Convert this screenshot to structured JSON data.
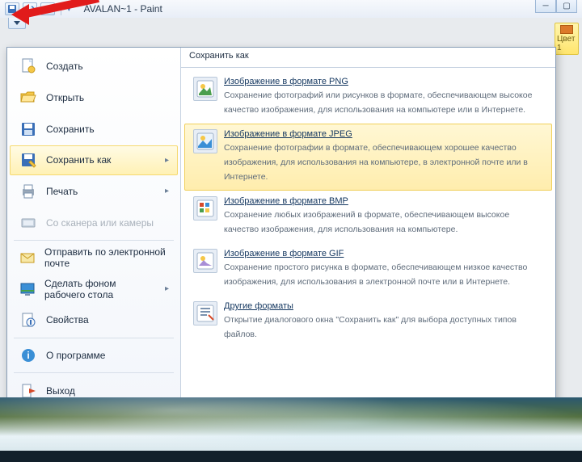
{
  "title": "AVALAN~1 - Paint",
  "panel_header": "Сохранить как",
  "menu_left": [
    {
      "label": "Создать",
      "icon": "new-doc"
    },
    {
      "label": "Открыть",
      "icon": "folder-open"
    },
    {
      "label": "Сохранить",
      "icon": "save"
    },
    {
      "label": "Сохранить как",
      "icon": "save-as",
      "submenu": true,
      "selected": true
    },
    {
      "label": "Печать",
      "icon": "printer",
      "submenu": true
    },
    {
      "label": "Со сканера или камеры",
      "icon": "scanner",
      "disabled": true
    },
    {
      "label": "Отправить по электронной почте",
      "icon": "mail"
    },
    {
      "label": "Сделать фоном рабочего стола",
      "icon": "desktop-bg",
      "submenu": true
    },
    {
      "label": "Свойства",
      "icon": "properties"
    },
    {
      "label": "О программе",
      "icon": "info"
    },
    {
      "label": "Выход",
      "icon": "exit"
    }
  ],
  "formats": [
    {
      "title": "Изображение в формате PNG",
      "desc": "Сохранение фотографий или рисунков в формате, обеспечивающем высокое качество изображения, для использования на компьютере или в Интернете.",
      "icon": "png"
    },
    {
      "title": "Изображение в формате JPEG",
      "desc": "Сохранение фотографии в формате, обеспечивающем хорошее качество изображения, для использования на компьютере, в электронной почте или в Интернете.",
      "icon": "jpeg",
      "selected": true
    },
    {
      "title": "Изображение в формате BMP",
      "desc": "Сохранение любых изображений в формате, обеспечивающем высокое качество изображения, для использования на компьютере.",
      "icon": "bmp"
    },
    {
      "title": "Изображение в формате GIF",
      "desc": "Сохранение простого рисунка в формате, обеспечивающем низкое качество изображения, для использования в электронной почте или в Интернете.",
      "icon": "gif"
    },
    {
      "title": "Другие форматы",
      "desc": "Открытие диалогового окна \"Сохранить как\" для выбора доступных типов файлов.",
      "icon": "other"
    }
  ],
  "peek_label": "Цвет 1"
}
